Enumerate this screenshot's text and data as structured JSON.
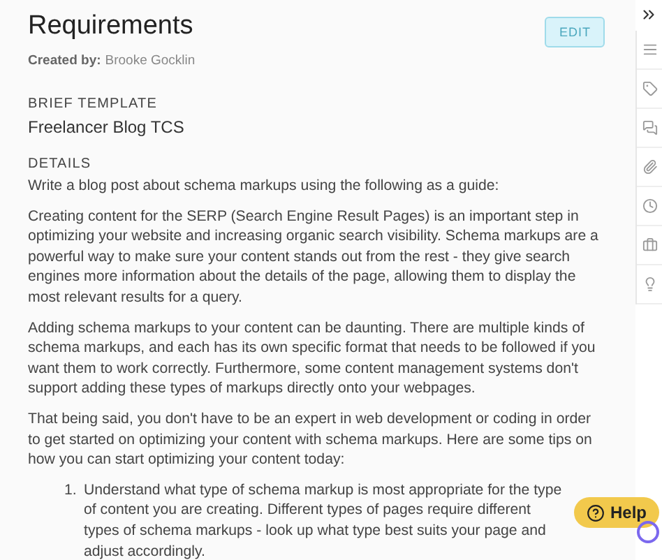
{
  "header": {
    "title": "Requirements",
    "edit_button": "EDIT",
    "created_by_label": "Created by:",
    "created_by_name": "Brooke Gocklin"
  },
  "brief_template": {
    "label": "BRIEF TEMPLATE",
    "value": "Freelancer Blog TCS"
  },
  "details": {
    "label": "DETAILS",
    "paragraphs": [
      "Write a blog post about schema markups using the following as a guide:",
      "Creating content for the SERP (Search Engine Result Pages) is an important step in optimizing your website and increasing organic search visibility. Schema markups are a powerful way to make sure your content stands out from the rest - they give search engines more information about the details of the page, allowing them to display the most relevant results for a query.",
      "Adding schema markups to your content can be daunting. There are multiple kinds of schema markups, and each has its own specific format that needs to be followed if you want them to work correctly. Furthermore, some content management systems don't support adding these types of markups directly onto your webpages.",
      "That being said, you don't have to be an expert in web development or coding in order to get started on optimizing your content with schema markups. Here are some tips on how you can start optimizing your content today:"
    ],
    "list": [
      {
        "marker": "1.",
        "text": "Understand what type of schema markup is most appropriate for the type of content you are creating. Different types of pages require different types of schema markups - look up what type best suits your page and adjust accordingly."
      }
    ]
  },
  "help_button": "Help"
}
